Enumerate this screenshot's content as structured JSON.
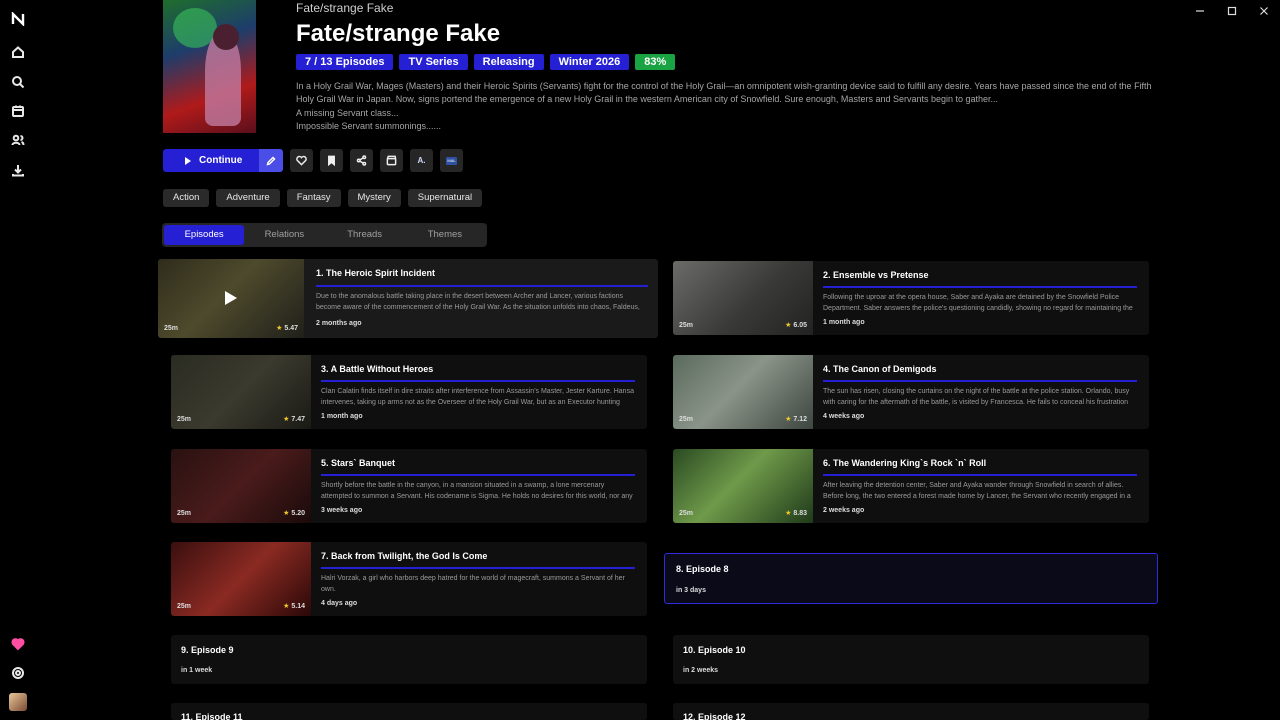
{
  "window": {
    "controls": [
      "minimize",
      "maximize",
      "close"
    ]
  },
  "sidebar": {
    "logo": "app-logo-icon",
    "nav": [
      "home-icon",
      "search-icon",
      "calendar-icon",
      "users-icon",
      "download-icon"
    ],
    "bottom": [
      "heart-icon",
      "settings-icon",
      "profile-avatar"
    ]
  },
  "anime": {
    "native_title": "Fate/strange Fake",
    "title": "Fate/strange Fake",
    "badges": {
      "episodes": "7 / 13 Episodes",
      "format": "TV Series",
      "status": "Releasing",
      "season": "Winter 2026",
      "score": "83%"
    },
    "synopsis": [
      "In a Holy Grail War, Mages (Masters) and their Heroic Spirits (Servants) fight for the control of the Holy Grail—an omnipotent wish-granting device said to fulfill any desire. Years have passed since the end of the Fifth Holy Grail War in Japan. Now, signs portend the emergence of a new Holy Grail in the western American city of Snowfield. Sure enough, Masters and Servants begin to gather...",
      "A missing Servant class...",
      "Impossible Servant summonings......"
    ]
  },
  "actions": {
    "continue_label": "Continue",
    "buttons": [
      "heart-icon",
      "bookmark-icon",
      "share-icon",
      "clapperboard-icon",
      "anilist-icon",
      "mal-icon"
    ],
    "anilist_text": "A.",
    "mal_text": "MAL"
  },
  "genres": [
    "Action",
    "Adventure",
    "Fantasy",
    "Mystery",
    "Supernatural"
  ],
  "tabs": [
    "Episodes",
    "Relations",
    "Threads",
    "Themes"
  ],
  "episodes": [
    {
      "title": "1. The Heroic Spirit Incident",
      "desc": "Due to the anomalous battle taking place in the desert between Archer and Lancer, various factions become aware of the commencement of the Holy Grail War. As the situation unfolds into chaos, Faldeus, tirelessly",
      "when": "2 months ago",
      "duration": "25m",
      "rating": "5.47"
    },
    {
      "title": "2. Ensemble vs Pretense",
      "desc": "Following the uproar at the opera house, Saber and Ayaka are detained by the Snowfield Police Department. Saber answers the police's questioning candidly, showing no regard for maintaining the secrecy of the Holy",
      "when": "1 month ago",
      "duration": "25m",
      "rating": "6.05"
    },
    {
      "title": "3. A Battle Without Heroes",
      "desc": "Clan Calatin finds itself in dire straits after interference from Assassin's Master, Jester Karture. Hansa intervenes, taking up arms not as the Overseer of the Holy Grail War, but as an Executor hunting Dead",
      "when": "1 month ago",
      "duration": "25m",
      "rating": "7.47"
    },
    {
      "title": "4. The Canon of Demigods",
      "desc": "The sun has risen, closing the curtains on the night of the battle at the police station. Orlando, busy with caring for the aftermath of the battle, is visited by Francesca. He fails to conceal his frustration towards",
      "when": "4 weeks ago",
      "duration": "25m",
      "rating": "7.12"
    },
    {
      "title": "5. Stars` Banquet",
      "desc": "Shortly before the battle in the canyon, in a mansion situated in a swamp, a lone mercenary attempted to summon a Servant. His codename is Sigma. He holds no desires for this world, nor any intention of leaving",
      "when": "3 weeks ago",
      "duration": "25m",
      "rating": "5.20"
    },
    {
      "title": "6. The Wandering King`s Rock `n` Roll",
      "desc": "After leaving the detention center, Saber and Ayaka wander through Snowfield in search of allies. Before long, the two entered a forest made home by Lancer, the Servant who recently engaged in a spectacular",
      "when": "2 weeks ago",
      "duration": "25m",
      "rating": "8.83"
    },
    {
      "title": "7. Back from Twilight, the God Is Come",
      "desc": "Halri Vorzak, a girl who harbors deep hatred for the world of magecraft, summons a Servant of her own.",
      "when": "4 days ago",
      "duration": "25m",
      "rating": "5.14"
    },
    {
      "title": "8. Episode 8",
      "when": "in 3 days"
    },
    {
      "title": "9. Episode 9",
      "when": "in 1 week"
    },
    {
      "title": "10. Episode 10",
      "when": "in 2 weeks"
    },
    {
      "title": "11. Episode 11",
      "when": ""
    },
    {
      "title": "12. Episode 12",
      "when": ""
    }
  ]
}
